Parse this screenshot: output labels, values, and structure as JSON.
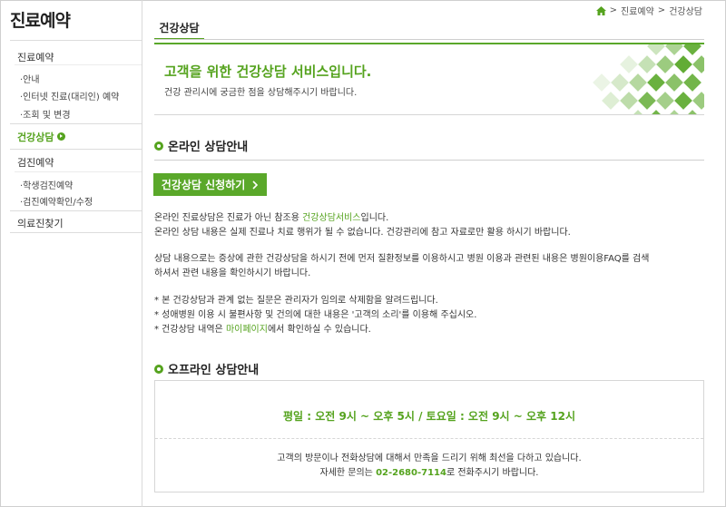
{
  "sidebar": {
    "title": "진료예약",
    "groups": [
      {
        "label": "진료예약",
        "items": [
          "·안내",
          "·인터넷 진료(대리인) 예약",
          "·조회 및 변경"
        ]
      },
      {
        "label": "건강상담"
      },
      {
        "label": "검진예약",
        "items": [
          "·학생검진예약",
          "·검진예약확인/수정"
        ]
      },
      {
        "label": "의료진찾기"
      }
    ]
  },
  "breadcrumb": {
    "items": [
      "진료예약",
      "건강상담"
    ],
    "separator": ">"
  },
  "tab": {
    "label": "건강상담"
  },
  "banner": {
    "title": "고객을 위한 건강상담 서비스입니다.",
    "subtitle": "건강 관리시에 궁금한 점을 상담해주시기 바랍니다."
  },
  "online": {
    "title": "온라인 상담안내",
    "button": "건강상담 신청하기",
    "p1_line1_a": "온라인 진료상담은 진료가 아닌 참조용 ",
    "p1_line1_link": "건강상담서비스",
    "p1_line1_b": "입니다.",
    "p1_line2": "온라인 상담 내용은 실제 진료나 치료 행위가 될 수 없습니다. 건강관리에 참고 자료로만 활용 하시기 바랍니다.",
    "p2_line1": "상담 내용으로는 증상에 관한 건강상담을 하시기 전에 먼저 질환정보를 이용하시고 병원 이용과 관련된 내용은 병원이용FAQ를 검색",
    "p2_line2": "하셔서 관련 내용을 확인하시기 바랍니다.",
    "note1": "* 본 건강상담과 관계 없는 질문은 관리자가 임의로 삭제함을 알려드립니다.",
    "note2": "* 성애병원 이용 시 불편사항 및 건의에 대한 내용은 '고객의 소리'를 이용해 주십시오.",
    "note3_a": "* 건강상담 내역은 ",
    "note3_link": "마이페이지",
    "note3_b": "에서 확인하실 수 있습니다."
  },
  "offline": {
    "title": "오프라인 상담안내",
    "hours": "평일 : 오전 9시 ~ 오후 5시 / 토요일 : 오전 9시 ~ 오후 12시",
    "msg1": "고객의 방문이나 전화상담에 대해서 만족을 드리기 위해 최선을 다하고 있습니다.",
    "msg2_a": "자세한 문의는 ",
    "phone": "02-2680-7114",
    "msg2_b": "로 전화주시기 바랍니다."
  },
  "colors": {
    "accent": "#55a31e",
    "button": "#5aa82a",
    "border": "#cfcfcf"
  }
}
